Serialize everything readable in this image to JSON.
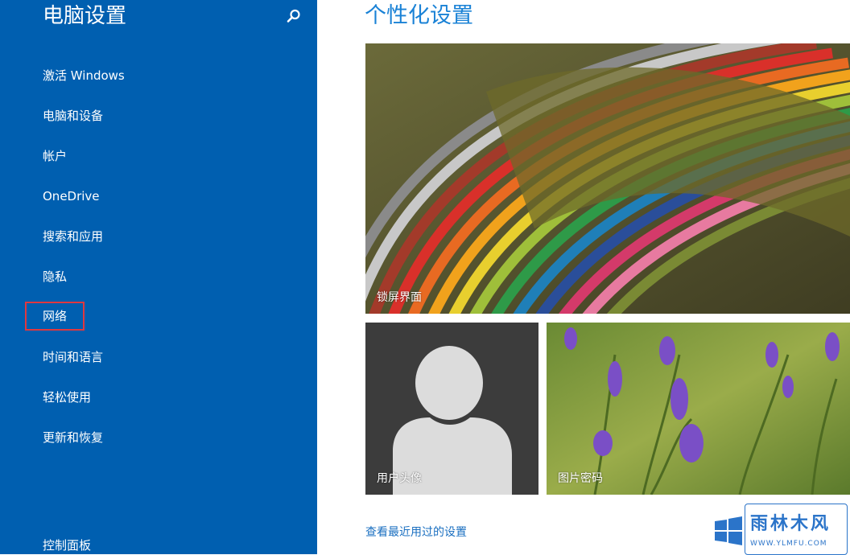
{
  "sidebar": {
    "title": "电脑设置",
    "items": [
      {
        "label": "激活 Windows"
      },
      {
        "label": "电脑和设备"
      },
      {
        "label": "帐户"
      },
      {
        "label": "OneDrive"
      },
      {
        "label": "搜索和应用"
      },
      {
        "label": "隐私"
      },
      {
        "label": "网络"
      },
      {
        "label": "时间和语言"
      },
      {
        "label": "轻松使用"
      },
      {
        "label": "更新和恢复"
      }
    ],
    "highlighted": "网络",
    "control_panel": "控制面板"
  },
  "main": {
    "title": "个性化设置",
    "tiles": {
      "lock_screen": "锁屏界面",
      "account_picture": "用户头像",
      "picture_password": "图片密码"
    },
    "recent_link": "查看最近用过的设置"
  },
  "watermark": {
    "text": "雨林木风",
    "url": "WWW.YLMFU.COM"
  },
  "colors": {
    "sidebar_bg": "#005fb0",
    "accent": "#1a82d6",
    "highlight_box": "#e0383f"
  },
  "icons": {
    "search": "search-icon"
  }
}
